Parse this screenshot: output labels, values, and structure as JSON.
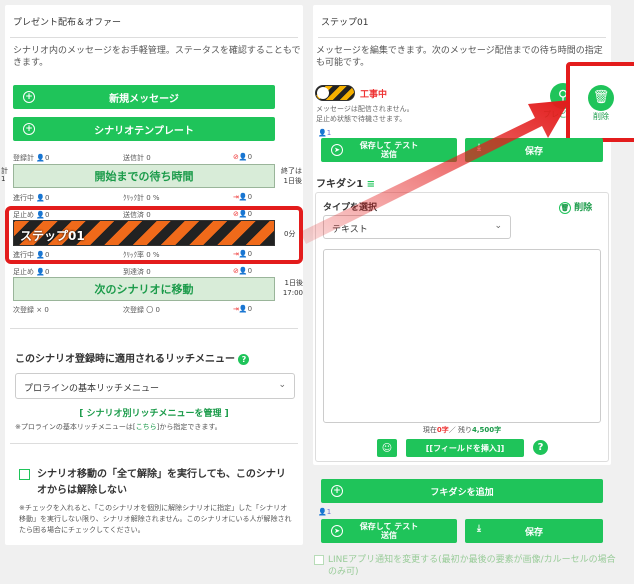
{
  "left": {
    "title": "プレゼント配布＆オファー",
    "desc": "シナリオ内のメッセージをお手軽管理。ステータスを確認することもできます。",
    "btn_new": "新規メッセージ",
    "btn_tpl": "シナリオテンプレート",
    "stats1": {
      "a": "登録計",
      "a_v": "0",
      "b": "送信計",
      "b_v": "0",
      "c_v": "0"
    },
    "start_wait": "開始までの待ち時間",
    "side_end": "終了は",
    "side_day": "1日後",
    "side_total": "計",
    "side_total_v": "1",
    "stats2": {
      "a": "進行中",
      "a_v": "0",
      "b": "ｸﾘｯｸ計",
      "b_v": "0 %",
      "c_v": "0"
    },
    "stats3": {
      "a": "足止め",
      "a_v": "0",
      "b": "送信済",
      "b_v": "0",
      "c_v": "0"
    },
    "step_label": "ステップ01",
    "step_time": "0分",
    "stats4": {
      "a": "進行中",
      "a_v": "0",
      "b": "ｸﾘｯｸ率",
      "b_v": "0 %",
      "c_v": "0"
    },
    "stats5": {
      "a": "足止め",
      "a_v": "0",
      "b": "到達済",
      "b_v": "0",
      "c_v": "0"
    },
    "next_scenario": "次のシナリオに移動",
    "next_day": "1日後",
    "next_time": "17:00",
    "stats6": {
      "a": "次登録",
      "a_v": "×",
      "a_v2": "0",
      "b": "次登録",
      "b_v": "〇",
      "b_v2": "0",
      "c_v": "0"
    },
    "rich_title": "このシナリオ登録時に適用されるリッチメニュー",
    "rich_select": "プロラインの基本リッチメニュー",
    "rich_link": "[ シナリオ別リッチメニューを管理 ]",
    "rich_note_pre": "※プロラインの基本リッチメニューは[",
    "rich_note_link": "こちら",
    "rich_note_post": "]から指定できます。",
    "unsub_title": "シナリオ移動の「全て解除」を実行しても、このシナリオからは解除しない",
    "unsub_note": "※チェックを入れると、「このシナリオを個別に解除シナリオに指定」した「シナリオ移動」を実行しない限り、シナリオ解除されません。このシナリオにいる人が解除されたら困る場合にチェックしてください。"
  },
  "right": {
    "title": "ステップ01",
    "desc": "メッセージを編集できます。次のメッセージ配信までの待ち時間の指定も可能です。",
    "status": "工事中",
    "status_note1": "メッセージは配信されません。",
    "status_note2": "足止め状態で待機させます。",
    "preview": "プレビュー",
    "delete": "削除",
    "count1": "1",
    "save_test": "保存して テスト送信",
    "save": "保存",
    "fukidashi": "フキダシ1",
    "type_label": "タイプを選択",
    "type_delete": "削除",
    "type_value": "テキスト",
    "counter_pre": "現在",
    "counter_now": "0字",
    "counter_mid": "／ 残り",
    "counter_left": "4,500字",
    "insert_field": "[[フィールドを挿入]]",
    "add_fukidashi": "フキダシを追加",
    "count2": "1",
    "line_notify": "LINEアプリ通知を変更する(最初か最後の要素が画像/カルーセルの場合のみ可)"
  },
  "colors": {
    "green": "#1fc45a",
    "red": "#e33",
    "orange": "#f06a1a"
  }
}
